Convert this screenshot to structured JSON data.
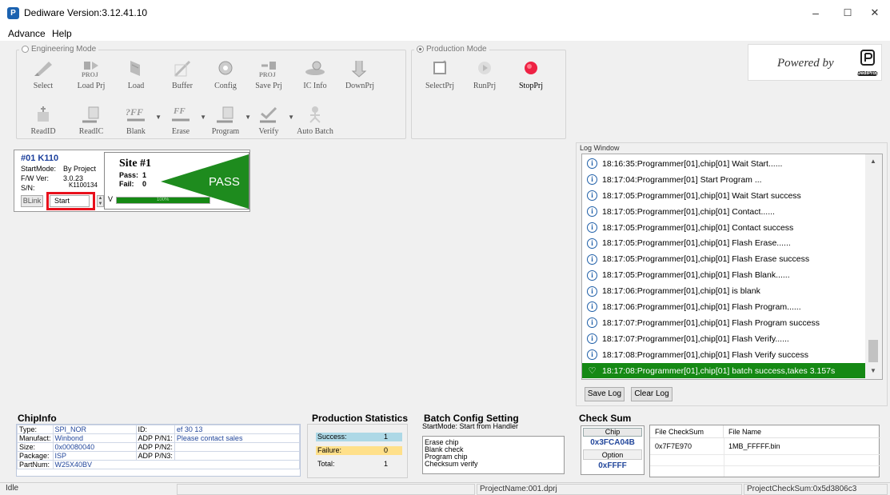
{
  "window": {
    "title": "Dediware Version:3.12.41.10",
    "app_icon": "dediprog-icon",
    "minimize": "–",
    "maximize": "☐",
    "close": "✕"
  },
  "menu": [
    "Advance",
    "Help"
  ],
  "engineering": {
    "title": "Engineering Mode",
    "row1": [
      {
        "label": "Select",
        "icon": "select-icon"
      },
      {
        "label": "Load Prj",
        "icon": "load-project-icon"
      },
      {
        "label": "Load",
        "icon": "load-icon"
      },
      {
        "label": "Buffer",
        "icon": "buffer-icon"
      },
      {
        "label": "Config",
        "icon": "config-icon"
      },
      {
        "label": "Save Prj",
        "icon": "save-project-icon"
      },
      {
        "label": "IC Info",
        "icon": "ic-info-icon"
      },
      {
        "label": "DownPrj",
        "icon": "download-project-icon"
      }
    ],
    "row2": [
      {
        "label": "ReadID",
        "icon": "read-id-icon"
      },
      {
        "label": "ReadIC",
        "icon": "read-ic-icon"
      },
      {
        "label": "Blank",
        "icon": "blank-icon"
      },
      {
        "label": "Erase",
        "icon": "erase-icon"
      },
      {
        "label": "Program",
        "icon": "program-icon"
      },
      {
        "label": "Verify",
        "icon": "verify-icon"
      },
      {
        "label": "Auto Batch",
        "icon": "auto-batch-icon"
      }
    ],
    "proj_text": "PROJ",
    "blank_text": "?FF",
    "erase_text": "FF"
  },
  "production": {
    "title": "Production Mode",
    "items": [
      {
        "label": "SelectPrj",
        "icon": "select-project-icon"
      },
      {
        "label": "RunPrj",
        "icon": "run-project-icon"
      },
      {
        "label": "StopPrj",
        "icon": "stop-project-icon"
      }
    ]
  },
  "powered": {
    "text": "Powered by",
    "logo_text": "DediProg"
  },
  "site": {
    "id": "#01 K110",
    "startmode_label": "StartMode:",
    "startmode": "By Project",
    "fw_label": "F/W Ver:",
    "fw": "3.0.23",
    "sn_label": "S/N:",
    "sn": "K1100134",
    "blink": "BLink",
    "start": "Start",
    "site_title": "Site #1",
    "pass_label": "Pass:",
    "pass": "1",
    "fail_label": "Fail:",
    "fail": "0",
    "result": "PASS",
    "v_label": "V",
    "progress_text": "100%",
    "progress": 1.0
  },
  "log": {
    "title": "Log Window",
    "lines": [
      "18:16:35:Programmer[01],chip[01] Wait Start......",
      "18:17:04:Programmer[01] Start Program ...",
      "18:17:05:Programmer[01],chip[01] Wait Start success",
      "18:17:05:Programmer[01],chip[01] Contact......",
      "18:17:05:Programmer[01],chip[01] Contact success",
      "18:17:05:Programmer[01],chip[01] Flash Erase......",
      "18:17:05:Programmer[01],chip[01] Flash Erase success",
      "18:17:05:Programmer[01],chip[01] Flash Blank......",
      "18:17:06:Programmer[01],chip[01] is blank",
      "18:17:06:Programmer[01],chip[01] Flash Program......",
      "18:17:07:Programmer[01],chip[01] Flash Program success",
      "18:17:07:Programmer[01],chip[01] Flash Verify......",
      "18:17:08:Programmer[01],chip[01] Flash Verify success"
    ],
    "highlight": "18:17:08:Programmer[01],chip[01] batch success,takes 3.157s",
    "save": "Save Log",
    "clear": "Clear Log"
  },
  "chipinfo": {
    "title": "ChipInfo",
    "rows": [
      [
        "Type:",
        "SPI_NOR",
        "ID:",
        "ef 30 13"
      ],
      [
        "Manufact:",
        "Winbond",
        "ADP P/N1:",
        "Please contact sales"
      ],
      [
        "Size:",
        "0x00080040",
        "ADP P/N2:",
        ""
      ],
      [
        "Package:",
        "ISP",
        "ADP P/N3:",
        ""
      ]
    ],
    "partnum_label": "PartNum:",
    "partnum": "W25X40BV"
  },
  "stats": {
    "title": "Production Statistics",
    "success_label": "Success:",
    "success": "1",
    "failure_label": "Failure:",
    "failure": "0",
    "total_label": "Total:",
    "total": "1",
    "success_color": "#add8e6",
    "failure_color": "#ffe08a"
  },
  "batch": {
    "title": "Batch Config Setting",
    "startmode": "StartMode:  Start from Handler",
    "items": [
      "Erase chip",
      "Blank check",
      "Program chip",
      "Checksum verify"
    ]
  },
  "checksum": {
    "title": "Check Sum",
    "chip_label": "Chip",
    "chip_value": "0x3FCA04B",
    "option_label": "Option",
    "option_value": "0xFFFF",
    "headers": [
      "File CheckSum",
      "File Name"
    ],
    "file_checksum": "0x7F7E970",
    "file_name": "1MB_FFFFF.bin"
  },
  "status": {
    "state": "Idle",
    "project": "ProjectName:001.dprj",
    "checksum": "ProjectCheckSum:0x5d3806c3"
  }
}
